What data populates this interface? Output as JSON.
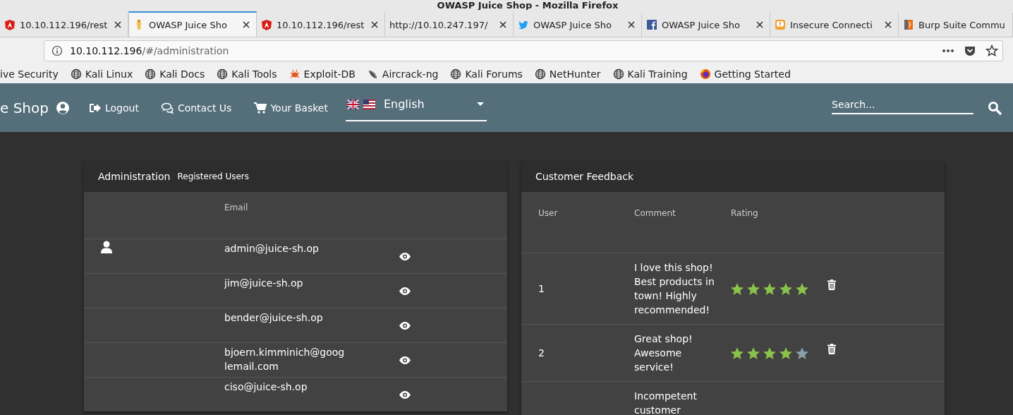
{
  "window": {
    "title": "OWASP Juice Shop - Mozilla Firefox"
  },
  "tabs": [
    {
      "kind": "angular",
      "label": "10.10.112.196/rest",
      "selected": false,
      "close_button": true
    },
    {
      "kind": "juice",
      "label": "OWASP Juice Sho",
      "selected": true,
      "close_button": true
    },
    {
      "kind": "angular",
      "label": "10.10.112.196/rest",
      "selected": false,
      "close_button": true
    },
    {
      "kind": "none",
      "label": "http://10.10.247.197/",
      "selected": false,
      "close_button": true
    },
    {
      "kind": "twitter",
      "label": "OWASP Juice Sho",
      "selected": false,
      "close_button": true
    },
    {
      "kind": "facebook",
      "label": "OWASP Juice Sho",
      "selected": false,
      "close_button": true
    },
    {
      "kind": "warning",
      "label": "Insecure Connecti",
      "selected": false,
      "close_button": true
    },
    {
      "kind": "burp",
      "label": "Burp Suite Commu",
      "selected": false,
      "close_button": false
    }
  ],
  "address_bar": {
    "host": "10.10.112.196",
    "path": "/#/administration"
  },
  "bookmarks": [
    {
      "kind": "none",
      "label": "ive Security"
    },
    {
      "kind": "globe",
      "label": "Kali Linux"
    },
    {
      "kind": "globe",
      "label": "Kali Docs"
    },
    {
      "kind": "globe",
      "label": "Kali Tools"
    },
    {
      "kind": "bug",
      "label": "Exploit-DB"
    },
    {
      "kind": "antenna",
      "label": "Aircrack-ng"
    },
    {
      "kind": "globe",
      "label": "Kali Forums"
    },
    {
      "kind": "globe",
      "label": "NetHunter"
    },
    {
      "kind": "globe",
      "label": "Kali Training"
    },
    {
      "kind": "firefox",
      "label": "Getting Started"
    }
  ],
  "navbar": {
    "brand": "e Shop",
    "links": [
      {
        "kind": "logout",
        "label": "Logout"
      },
      {
        "kind": "contact",
        "label": "Contact Us"
      },
      {
        "kind": "basket",
        "label": "Your Basket"
      }
    ],
    "language": "English",
    "search": {
      "placeholder": "Search..."
    }
  },
  "administration": {
    "title": "Administration",
    "subtitle": "Registered Users",
    "columns": [
      "Email"
    ],
    "rows": [
      {
        "email": "admin@juice-sh.op",
        "user_icon": true
      },
      {
        "email": "jim@juice-sh.op",
        "user_icon": false
      },
      {
        "email": "bender@juice-sh.op",
        "user_icon": false
      },
      {
        "email": "bjoern.kimminich@googlemail.com",
        "user_icon": false
      },
      {
        "email": "ciso@juice-sh.op",
        "user_icon": false
      }
    ]
  },
  "feedback": {
    "title": "Customer Feedback",
    "columns": [
      "User",
      "Comment",
      "Rating"
    ],
    "rows": [
      {
        "user": "1",
        "comment": "I love this shop! Best products in town! Highly recommended!",
        "stars": 5
      },
      {
        "user": "2",
        "comment": "Great shop! Awesome service!",
        "stars": 4
      },
      {
        "comment": "Incompetent customer"
      }
    ]
  }
}
